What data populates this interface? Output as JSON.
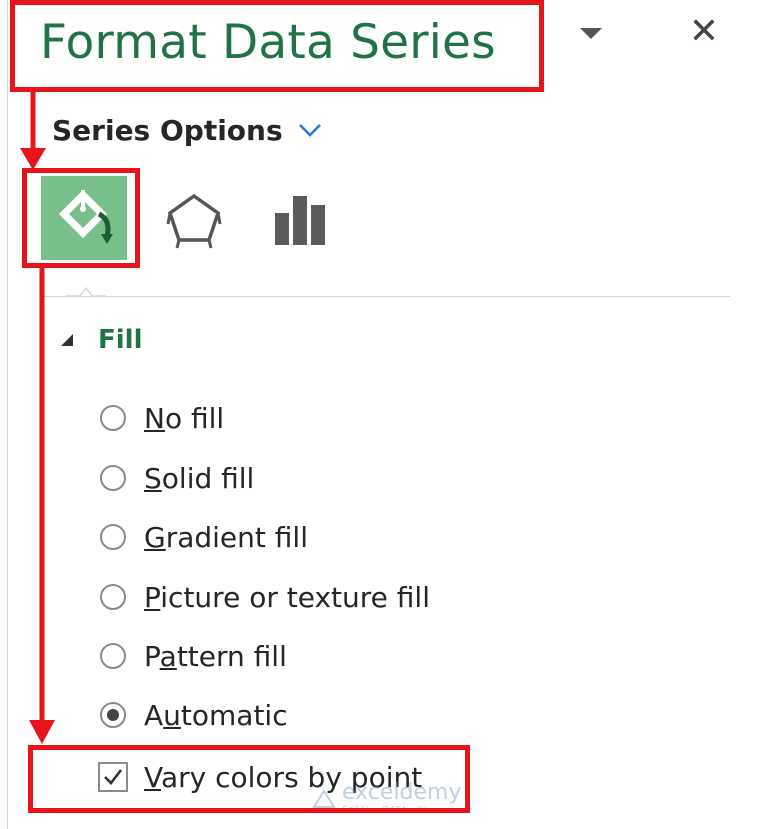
{
  "pane": {
    "title": "Format Data Series",
    "close_label": "✕"
  },
  "series_options": {
    "label": "Series Options"
  },
  "tabs": [
    {
      "name": "Fill & Line",
      "icon": "paint-bucket-icon",
      "selected": true
    },
    {
      "name": "Effects",
      "icon": "pentagon-icon",
      "selected": false
    },
    {
      "name": "Series Options",
      "icon": "bar-chart-icon",
      "selected": false
    }
  ],
  "fill": {
    "header": "Fill",
    "options": [
      {
        "pre": "",
        "u": "N",
        "post": "o fill",
        "selected": false
      },
      {
        "pre": "",
        "u": "S",
        "post": "olid fill",
        "selected": false
      },
      {
        "pre": "",
        "u": "G",
        "post": "radient fill",
        "selected": false
      },
      {
        "pre": "",
        "u": "P",
        "post": "icture or texture fill",
        "selected": false
      },
      {
        "pre": "P",
        "u": "a",
        "post": "ttern fill",
        "selected": false
      },
      {
        "pre": "A",
        "u": "u",
        "post": "tomatic",
        "selected": true
      }
    ],
    "vary_colors": {
      "pre": "",
      "u": "V",
      "post": "ary colors by point",
      "checked": true
    }
  },
  "watermark": {
    "name": "exceldemy",
    "tagline": "EXCEL · DATA · BI"
  },
  "colors": {
    "accent": "#217346",
    "selected_tab_bg": "#79bf8c",
    "annotation": "#e8141c"
  }
}
